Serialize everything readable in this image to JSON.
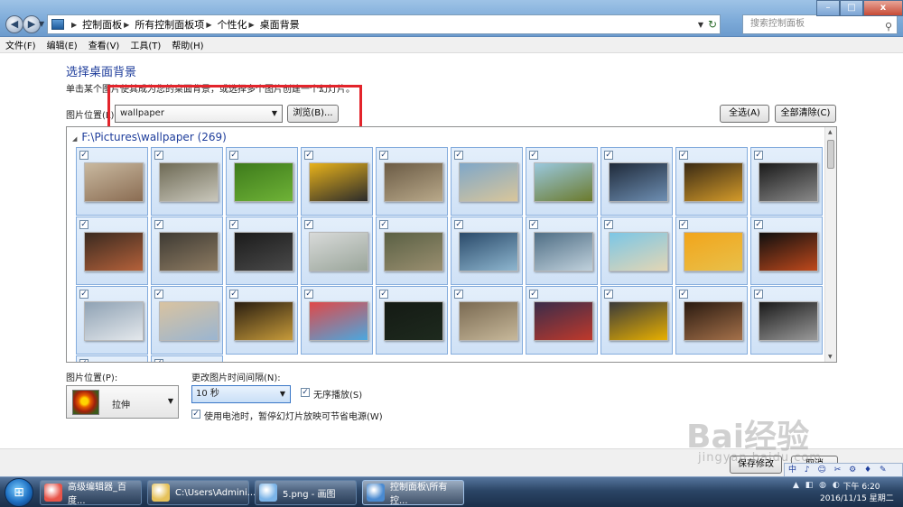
{
  "address_bar": {
    "crumbs": [
      "控制面板",
      "所有控制面板项",
      "个性化",
      "桌面背景"
    ],
    "search_placeholder": "搜索控制面板"
  },
  "window_controls": {
    "minimize": "–",
    "maximize": "□",
    "close": "x"
  },
  "menu": [
    "文件(F)",
    "编辑(E)",
    "查看(V)",
    "工具(T)",
    "帮助(H)"
  ],
  "page": {
    "title": "选择桌面背景",
    "instruction": "单击某个图片使其成为您的桌面背景，或选择多个图片创建一个幻灯片。",
    "location_label": "图片位置(L):",
    "location_value": "wallpaper",
    "browse_button": "浏览(B)...",
    "select_all_button": "全选(A)",
    "clear_all_button": "全部清除(C)"
  },
  "gallery": {
    "group_header": "F:\\Pictures\\wallpaper (269)",
    "checked_mark": "✓",
    "thumbnails": [
      [
        "#c9b9a0",
        "#8a6c52"
      ],
      [
        "#6e6a55",
        "#c9c7bb"
      ],
      [
        "#3d7a1b",
        "#6fb337"
      ],
      [
        "#e8b21a",
        "#2b2b2b"
      ],
      [
        "#6b5b45",
        "#b9a98a"
      ],
      [
        "#7fa7c9",
        "#d9c69a"
      ],
      [
        "#9ac8de",
        "#6b7a2c"
      ],
      [
        "#1f2a3a",
        "#6e8fb3"
      ],
      [
        "#3a2a14",
        "#d49b2a"
      ],
      [
        "#1a1a1a",
        "#8a8a8a"
      ],
      [
        "#3a2a20",
        "#b5613a"
      ],
      [
        "#3e3a33",
        "#8d7b62"
      ],
      [
        "#1b1b1b",
        "#4a4a4a"
      ],
      [
        "#d8dad9",
        "#9aa59a"
      ],
      [
        "#5a6044",
        "#9a8f70"
      ],
      [
        "#2a4a6a",
        "#8eb6cf"
      ],
      [
        "#4f6e85",
        "#c0d1dc"
      ],
      [
        "#7bc6e6",
        "#e3d6b4"
      ],
      [
        "#f2a51b",
        "#e8c04a"
      ],
      [
        "#0f0f0f",
        "#c0491c"
      ],
      [
        "#8fa2b4",
        "#e4e8ec"
      ],
      [
        "#d9c3a0",
        "#9ab5d1"
      ],
      [
        "#2a1e10",
        "#c79b3a"
      ],
      [
        "#e04848",
        "#4aa8e0"
      ],
      [
        "#141a14",
        "#1e2a1e"
      ],
      [
        "#7a6a52",
        "#c7b89a"
      ],
      [
        "#3a2c4a",
        "#c0392b"
      ],
      [
        "#3a3a3a",
        "#e8b000"
      ],
      [
        "#2a1a10",
        "#a5714a"
      ],
      [
        "#1a1a1a",
        "#9a9a9a"
      ],
      [
        "#3a1a10",
        "#e86a20"
      ],
      [
        "#1e6ab4",
        "#5bb0e6"
      ]
    ]
  },
  "options": {
    "position_label": "图片位置(P):",
    "position_value": "拉伸",
    "interval_label": "更改图片时间间隔(N):",
    "interval_value": "10 秒",
    "shuffle_label": "无序播放(S)",
    "battery_label": "使用电池时，暂停幻灯片放映可节省电源(W)"
  },
  "footer": {
    "save_button": "保存修改",
    "cancel_button": "取消"
  },
  "taskbar": {
    "start": "⊞",
    "tasks": [
      {
        "label": "高级编辑器_百度...",
        "color": "#e8554a"
      },
      {
        "label": "C:\\Users\\Admini...",
        "color": "#e6c25a"
      },
      {
        "label": "5.png - 画图",
        "color": "#7bb4e8"
      },
      {
        "label": "控制面板\\所有控...",
        "color": "#4a8ad0"
      }
    ],
    "ime": "中 ♪ ☺ ✂ ⚙ ♦ ✎",
    "tray_icons": "▲ ◧ ◍ ◐",
    "time": "下午 6:20",
    "date": "2016/11/15 星期二"
  },
  "watermark": {
    "brand": "Bai经验",
    "url": "jingyan.baidu.com"
  }
}
